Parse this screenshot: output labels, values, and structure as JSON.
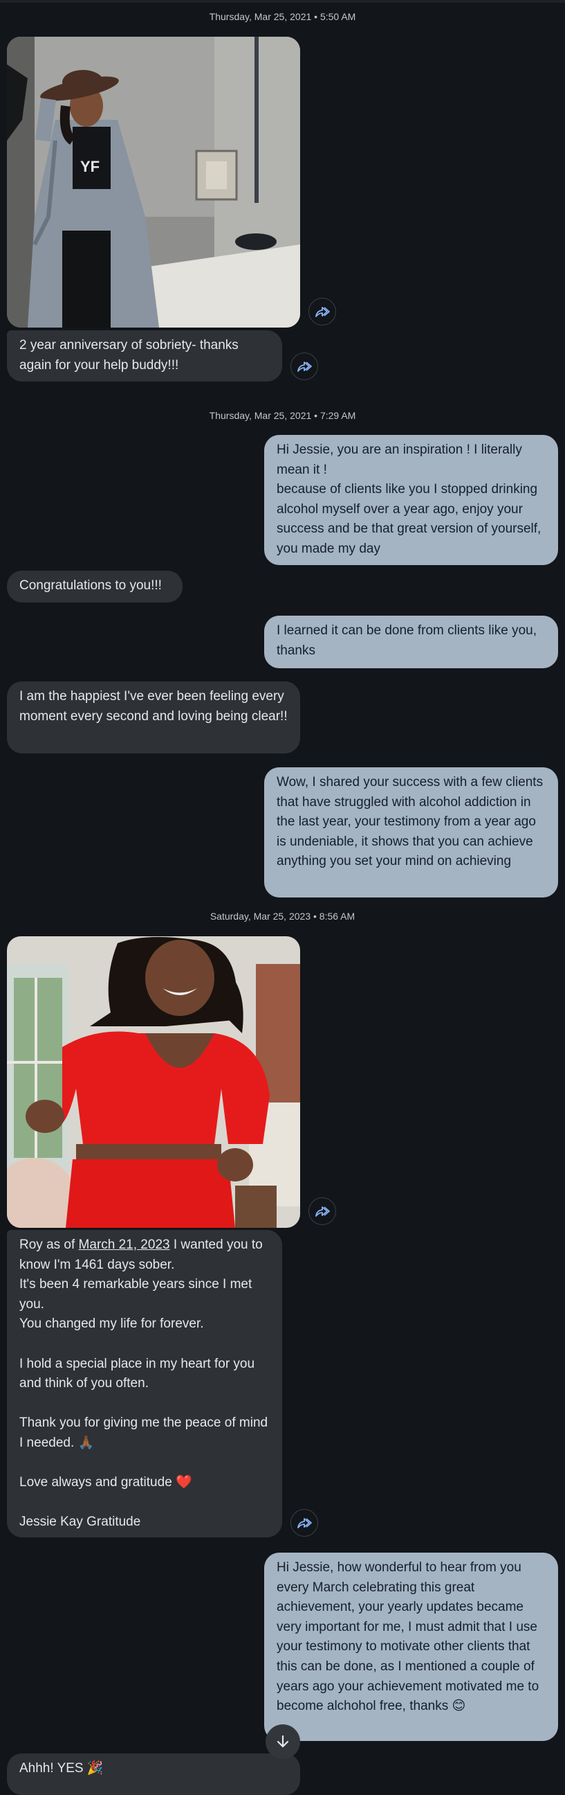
{
  "timestamps": {
    "t1": "Thursday, Mar 25, 2021 • 5:50 AM",
    "t2": "Thursday, Mar 25, 2021 • 7:29 AM",
    "t3": "Saturday, Mar 25, 2023 • 8:56 AM"
  },
  "messages": {
    "m1": "2 year anniversary of sobriety- thanks again for your help buddy!!!",
    "m2": "Hi Jessie,  you are an inspiration !  I literally mean it !\n because of clients like you I stopped drinking alcohol myself over a year ago, enjoy your success and be that great version of yourself,  you made my day",
    "m3": "Congratulations to you!!!",
    "m4": "I learned it can be done from clients like you, thanks",
    "m5": "I am the happiest I've ever been feeling every moment every second and loving being clear!!",
    "m6": "Wow,  I shared your success with a few clients that have struggled with alcohol addiction in the last year,  your testimony from a year ago is undeniable, it shows that you can achieve anything you set your mind on achieving",
    "m7_pre": "Roy as of ",
    "m7_link": "March 21, 2023",
    "m7_post": " I wanted you to know I'm 1461 days sober.\nIt's been 4 remarkable years since I met you.\nYou  changed my life for forever.\n\nI hold a special place in my heart for you and think of you often.\n\nThank you for giving me the peace of mind I needed. 🙏🏾\n\nLove always and gratitude ❤️\n\nJessie Kay Gratitude",
    "m8": "Hi Jessie,  how wonderful to hear from you every March celebrating  this great achievement, your yearly updates became very important for me, I must admit that I use your testimony to motivate other clients that this can be done, as I mentioned a couple of years ago your achievement motivated  me to become alchohol free, thanks 😊",
    "m9": "Ahhh! YES 🎉"
  },
  "photo1_text": "YF",
  "icons": {
    "forward": "forward-icon",
    "scroll": "arrow-down-icon"
  },
  "colors": {
    "background": "#121519",
    "incoming_bubble": "#2e3135",
    "outgoing_bubble": "#a5b4c3",
    "forward_icon": "#8ab4f8"
  }
}
